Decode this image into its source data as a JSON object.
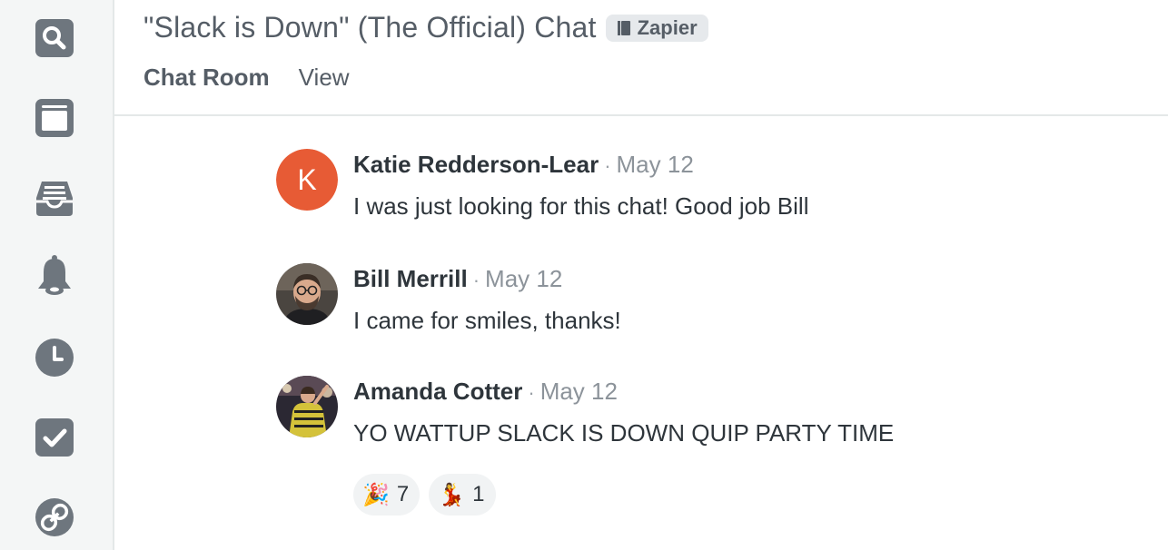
{
  "sidebar": {
    "items": [
      {
        "icon": "search-icon"
      },
      {
        "icon": "browser-window-icon"
      },
      {
        "icon": "inbox-tray-icon"
      },
      {
        "icon": "bell-icon"
      },
      {
        "icon": "clock-icon"
      },
      {
        "icon": "checkbox-icon"
      },
      {
        "icon": "link-icon"
      }
    ],
    "icon_color": "#6e767e"
  },
  "header": {
    "title": "\"Slack is Down\" (The Official) Chat",
    "badge": {
      "icon": "book-icon",
      "label": "Zapier"
    }
  },
  "tabs": [
    {
      "label": "Chat Room",
      "active": true
    },
    {
      "label": "View",
      "active": false
    }
  ],
  "messages": [
    {
      "author": "Katie Redderson-Lear",
      "date": "May 12",
      "text": "I was just looking for this chat! Good job Bill",
      "avatar": {
        "type": "initial",
        "letter": "K",
        "color": "#e75b35"
      }
    },
    {
      "author": "Bill Merrill",
      "date": "May 12",
      "text": "I came for smiles, thanks!",
      "avatar": {
        "type": "photo"
      }
    },
    {
      "author": "Amanda Cotter",
      "date": "May 12",
      "text": "YO WATTUP SLACK IS DOWN QUIP PARTY TIME",
      "avatar": {
        "type": "photo"
      },
      "reactions": [
        {
          "emoji": "🎉",
          "count": "7"
        },
        {
          "emoji": "💃",
          "count": "1"
        }
      ]
    }
  ],
  "separator": "·"
}
